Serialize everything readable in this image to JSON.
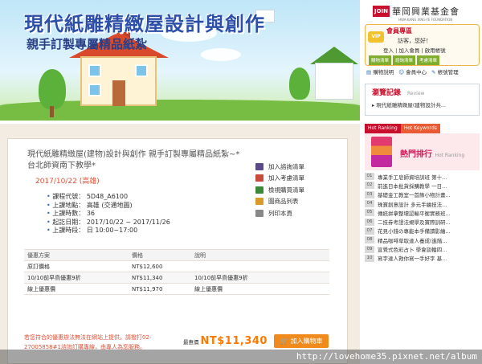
{
  "banner": {
    "title": "現代紙雕精緻屋設計與創作",
    "subtitle": "親手訂製專屬精品紙紮"
  },
  "sidebar": {
    "logo_badge": "JOIN",
    "logo_text": "華岡興業基金會",
    "logo_en": "HWA-KANG XING-YE FOUNDATION",
    "member_title": "會員專區",
    "vip": "VIP",
    "greeting": "訪客，您好！",
    "links": [
      "登入",
      "加入會員",
      "啟用帳號"
    ],
    "tabs": [
      "購物清單",
      "諮詢清單",
      "考慮清單"
    ],
    "row_links": [
      "購物說明",
      "會員中心",
      "帳號管理"
    ],
    "browse_title": "瀏覽記錄",
    "browse_sub": "Review",
    "browse_items": [
      "現代紙雕精緻屋(建物設計共..."
    ],
    "hot_tabs": [
      "Hot Ranking",
      "Hot Keywords"
    ],
    "hot_title": "熱門排行",
    "hot_sub": "Hot Ranking",
    "rankings": [
      {
        "no": "01",
        "text": "專業手工皂師資培訓班 第十..."
      },
      {
        "no": "02",
        "text": "前進日本批貨採購教學 一日..."
      },
      {
        "no": "03",
        "text": "基礎金工教室一首飾小物計畫..."
      },
      {
        "no": "04",
        "text": "珠寶創意設計 多元手繪技法..."
      },
      {
        "no": "05",
        "text": "傳統拼拿整壞認輸平衡實務班..."
      },
      {
        "no": "06",
        "text": "二技券考證法規學及寶際訓研..."
      },
      {
        "no": "07",
        "text": "花見小錢の專能本手備讀影繪..."
      },
      {
        "no": "08",
        "text": "精品咖啡草取達人養成(進階..."
      },
      {
        "no": "09",
        "text": "宣覺式色彩占卜 學會談輪四..."
      },
      {
        "no": "10",
        "text": "寫字達人救你寫一手好字 基..."
      }
    ]
  },
  "product": {
    "title": "現代紙雕精緻屋(建物)設計與創作 親手訂製專屬精品紙紮~*台北師資南下教學*",
    "date": "2017/10/22 (高雄)",
    "info": [
      {
        "label": "課程代號：",
        "value": "5D48_A6100"
      },
      {
        "label": "上課地點：",
        "value": "高雄 (交通地圖)"
      },
      {
        "label": "上課時數：",
        "value": "36"
      },
      {
        "label": "起訖日期：",
        "value": "2017/10/22 ~ 2017/11/26"
      },
      {
        "label": "上課時段：",
        "value": "日 10:00~17:00"
      }
    ],
    "actions": [
      "加入諮詢清單",
      "加入考慮清單",
      "檢視購買清單",
      "圖商品列表",
      "列印本頁"
    ]
  },
  "pricing": {
    "headers": [
      "優惠方案",
      "價格",
      "說明"
    ],
    "rows": [
      {
        "plan": "原訂價格",
        "price": "NT$12,600",
        "desc": ""
      },
      {
        "plan": "10/10前早鳥優惠9折",
        "price": "NT$11,340",
        "desc": "10/10前早鳥優惠9折"
      },
      {
        "plan": "線上優惠價",
        "price": "NT$11,970",
        "desc": "線上優惠價"
      }
    ]
  },
  "note": "若您符合的優惠辦法無法在網站上提供，請撥打02-27005858#1諮詢訂購專線，由專人為您服務。",
  "price_label": "最惠價",
  "price": "NT$11,340",
  "cart_label": "加入購物車",
  "watermark": "http://lovehome35.pixnet.net/album",
  "colors": {
    "accent": "#c8102e",
    "price": "#ff7a00",
    "date": "#d9533a",
    "banner_title": "#2d4fa8"
  }
}
